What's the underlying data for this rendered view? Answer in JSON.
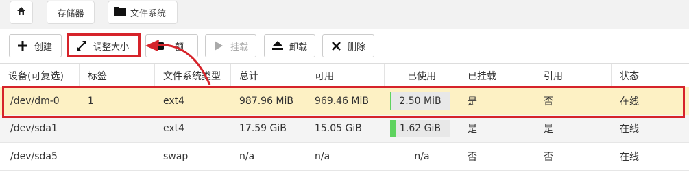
{
  "breadcrumb": {
    "home_icon": "home-icon",
    "storage": "存储器",
    "filesystem": "文件系统",
    "filesystem_icon": "folder-icon"
  },
  "toolbar": {
    "create": "创建",
    "resize": "调整大小",
    "quota_partial": "额",
    "mount": "挂载",
    "unmount": "卸载",
    "delete": "删除"
  },
  "table": {
    "headers": [
      "设备(可复选)",
      "标签",
      "文件系统类型",
      "总计",
      "可用",
      "已使用",
      "已挂载",
      "引用",
      "状态"
    ],
    "rows": [
      {
        "device": "/dev/dm-0",
        "label": "1",
        "type": "ext4",
        "total": "987.96 MiB",
        "available": "969.46 MiB",
        "used": "2.50 MiB",
        "used_fraction": 0.01,
        "mounted": "是",
        "referenced": "否",
        "status": "在线"
      },
      {
        "device": "/dev/sda1",
        "label": "",
        "type": "ext4",
        "total": "17.59 GiB",
        "available": "15.05 GiB",
        "used": "1.62 GiB",
        "used_fraction": 0.09,
        "mounted": "是",
        "referenced": "是",
        "status": "在线"
      },
      {
        "device": "/dev/sda5",
        "label": "",
        "type": "swap",
        "total": "n/a",
        "available": "n/a",
        "used": "n/a",
        "mounted": "否",
        "referenced": "否",
        "status": "在线"
      }
    ]
  },
  "colors": {
    "highlight": "#d6232a",
    "selected_row": "#fdf1c4",
    "usage_bar": "#5fd35f"
  }
}
